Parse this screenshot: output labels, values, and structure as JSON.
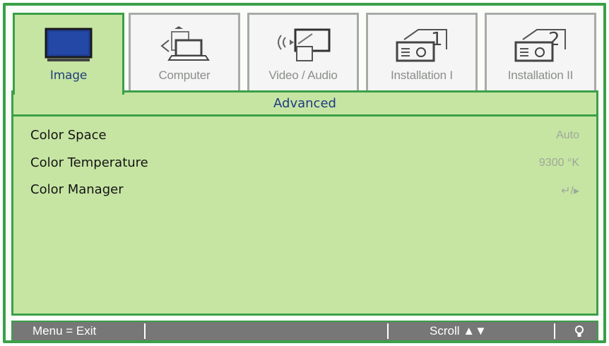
{
  "tabs": [
    {
      "label": "Image",
      "icon": "monitor-icon",
      "active": true
    },
    {
      "label": "Computer",
      "icon": "computer-icon",
      "active": false
    },
    {
      "label": "Video / Audio",
      "icon": "video-audio-icon",
      "active": false
    },
    {
      "label": "Installation I",
      "icon": "projector-1-icon",
      "active": false
    },
    {
      "label": "Installation II",
      "icon": "projector-2-icon",
      "active": false
    }
  ],
  "submenu": {
    "title": "Advanced"
  },
  "settings": [
    {
      "label": "Color Space",
      "value": "Auto"
    },
    {
      "label": "Color Temperature",
      "value": "9300 °K"
    },
    {
      "label": "Color Manager",
      "value": "↵/▸"
    }
  ],
  "statusbar": {
    "menu_exit": "Menu = Exit",
    "scroll": "Scroll ▲▼",
    "help_icon": "lightbulb-icon"
  },
  "colors": {
    "frame_green": "#3aa048",
    "panel_bg": "#c6e5a3",
    "status_bg": "#777777",
    "title_blue": "#203a80"
  }
}
